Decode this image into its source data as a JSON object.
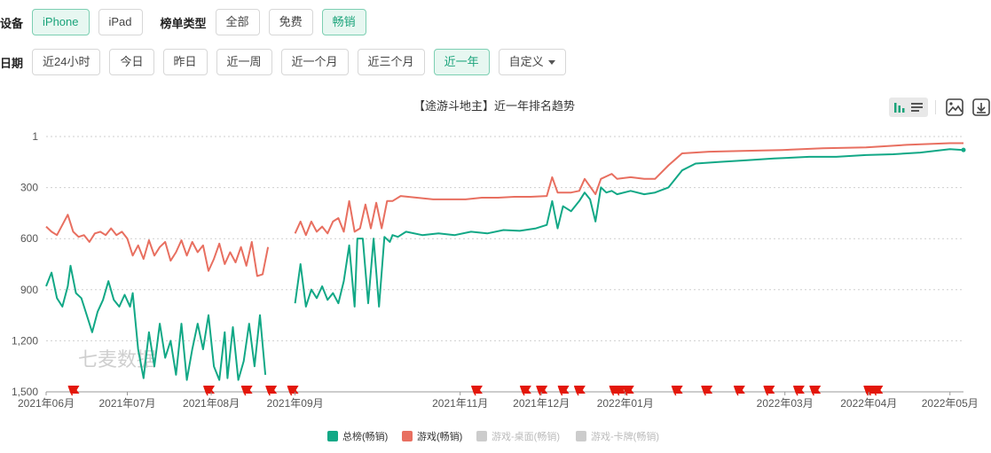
{
  "filters": {
    "device": {
      "label": "设备",
      "options": [
        "iPhone",
        "iPad"
      ],
      "selected": "iPhone"
    },
    "list_type": {
      "label": "榜单类型",
      "options": [
        "全部",
        "免费",
        "畅销"
      ],
      "selected": "畅销"
    },
    "date": {
      "label": "日期",
      "options": [
        "近24小时",
        "今日",
        "昨日",
        "近一周",
        "近一个月",
        "近三个月",
        "近一年"
      ],
      "selected": "近一年",
      "custom_label": "自定义"
    }
  },
  "toolbar": {
    "icons": [
      "bar-chart-icon",
      "list-icon",
      "image-icon",
      "download-icon"
    ]
  },
  "watermark": "七麦数据",
  "chart_data": {
    "type": "line",
    "title": "【途游斗地主】近一年排名趋势",
    "y_inverted": true,
    "ylim": [
      1,
      1500
    ],
    "yticks": [
      "1",
      "300",
      "600",
      "900",
      "1,200",
      "1,500"
    ],
    "x_range": [
      "2021-06-01",
      "2022-05-06"
    ],
    "xticks": [
      {
        "date": "2021-06-01",
        "label": "2021年06月"
      },
      {
        "date": "2021-07-01",
        "label": "2021年07月"
      },
      {
        "date": "2021-08-01",
        "label": "2021年08月"
      },
      {
        "date": "2021-09-01",
        "label": "2021年09月"
      },
      {
        "date": "2021-11-01",
        "label": "2021年11月"
      },
      {
        "date": "2021-12-01",
        "label": "2021年12月"
      },
      {
        "date": "2022-01-01",
        "label": "2022年01月"
      },
      {
        "date": "2022-03-01",
        "label": "2022年03月"
      },
      {
        "date": "2022-04-01",
        "label": "2022年04月"
      },
      {
        "date": "2022-05-01",
        "label": "2022年05月"
      }
    ],
    "grid": "horizontal dotted",
    "legend_position": "bottom",
    "series": [
      {
        "name": "总榜(畅销)",
        "color": "#12a886",
        "active": true,
        "points": [
          [
            "2021-06-01",
            880
          ],
          [
            "2021-06-03",
            800
          ],
          [
            "2021-06-05",
            950
          ],
          [
            "2021-06-07",
            1000
          ],
          [
            "2021-06-09",
            880
          ],
          [
            "2021-06-10",
            760
          ],
          [
            "2021-06-12",
            920
          ],
          [
            "2021-06-14",
            950
          ],
          [
            "2021-06-16",
            1050
          ],
          [
            "2021-06-18",
            1150
          ],
          [
            "2021-06-20",
            1030
          ],
          [
            "2021-06-22",
            960
          ],
          [
            "2021-06-24",
            850
          ],
          [
            "2021-06-26",
            960
          ],
          [
            "2021-06-28",
            1000
          ],
          [
            "2021-06-30",
            930
          ],
          [
            "2021-07-02",
            1000
          ],
          [
            "2021-07-03",
            920
          ],
          [
            "2021-07-05",
            1250
          ],
          [
            "2021-07-07",
            1420
          ],
          [
            "2021-07-09",
            1150
          ],
          [
            "2021-07-11",
            1350
          ],
          [
            "2021-07-13",
            1100
          ],
          [
            "2021-07-15",
            1300
          ],
          [
            "2021-07-17",
            1200
          ],
          [
            "2021-07-19",
            1400
          ],
          [
            "2021-07-21",
            1100
          ],
          [
            "2021-07-23",
            1430
          ],
          [
            "2021-07-25",
            1250
          ],
          [
            "2021-07-27",
            1100
          ],
          [
            "2021-07-29",
            1250
          ],
          [
            "2021-07-31",
            1050
          ],
          [
            "2021-08-02",
            1350
          ],
          [
            "2021-08-04",
            1430
          ],
          [
            "2021-08-06",
            1150
          ],
          [
            "2021-08-07",
            1420
          ],
          [
            "2021-08-09",
            1120
          ],
          [
            "2021-08-11",
            1430
          ],
          [
            "2021-08-13",
            1320
          ],
          [
            "2021-08-15",
            1100
          ],
          [
            "2021-08-17",
            1350
          ],
          [
            "2021-08-19",
            1050
          ],
          [
            "2021-08-21",
            1400
          ],
          [
            null,
            null
          ],
          [
            "2021-09-01",
            980
          ],
          [
            "2021-09-03",
            750
          ],
          [
            "2021-09-05",
            1000
          ],
          [
            "2021-09-07",
            900
          ],
          [
            "2021-09-09",
            950
          ],
          [
            "2021-09-11",
            880
          ],
          [
            "2021-09-13",
            960
          ],
          [
            "2021-09-15",
            920
          ],
          [
            "2021-09-17",
            980
          ],
          [
            "2021-09-19",
            850
          ],
          [
            "2021-09-21",
            640
          ],
          [
            "2021-09-23",
            1000
          ],
          [
            "2021-09-24",
            600
          ],
          [
            "2021-09-26",
            600
          ],
          [
            "2021-09-28",
            980
          ],
          [
            "2021-09-30",
            600
          ],
          [
            "2021-10-02",
            1000
          ],
          [
            "2021-10-04",
            590
          ],
          [
            "2021-10-06",
            620
          ],
          [
            "2021-10-07",
            580
          ],
          [
            "2021-10-09",
            590
          ],
          [
            "2021-10-12",
            560
          ],
          [
            "2021-10-18",
            580
          ],
          [
            "2021-10-24",
            570
          ],
          [
            "2021-10-30",
            580
          ],
          [
            "2021-11-05",
            560
          ],
          [
            "2021-11-11",
            570
          ],
          [
            "2021-11-17",
            550
          ],
          [
            "2021-11-23",
            555
          ],
          [
            "2021-11-29",
            540
          ],
          [
            "2021-12-03",
            520
          ],
          [
            "2021-12-05",
            380
          ],
          [
            "2021-12-07",
            540
          ],
          [
            "2021-12-09",
            410
          ],
          [
            "2021-12-12",
            440
          ],
          [
            "2021-12-15",
            380
          ],
          [
            "2021-12-17",
            330
          ],
          [
            "2021-12-19",
            370
          ],
          [
            "2021-12-21",
            500
          ],
          [
            "2021-12-23",
            300
          ],
          [
            "2021-12-25",
            330
          ],
          [
            "2021-12-27",
            320
          ],
          [
            "2021-12-29",
            340
          ],
          [
            "2022-01-03",
            320
          ],
          [
            "2022-01-08",
            340
          ],
          [
            "2022-01-12",
            330
          ],
          [
            "2022-01-17",
            300
          ],
          [
            "2022-01-22",
            200
          ],
          [
            "2022-01-27",
            160
          ],
          [
            "2022-02-05",
            150
          ],
          [
            "2022-02-15",
            140
          ],
          [
            "2022-02-25",
            130
          ],
          [
            "2022-03-10",
            120
          ],
          [
            "2022-03-20",
            120
          ],
          [
            "2022-03-31",
            110
          ],
          [
            "2022-04-10",
            105
          ],
          [
            "2022-04-20",
            95
          ],
          [
            "2022-05-01",
            75
          ],
          [
            "2022-05-06",
            80
          ]
        ]
      },
      {
        "name": "游戏(畅销)",
        "color": "#e86f60",
        "active": true,
        "points": [
          [
            "2021-06-01",
            530
          ],
          [
            "2021-06-03",
            560
          ],
          [
            "2021-06-05",
            580
          ],
          [
            "2021-06-07",
            520
          ],
          [
            "2021-06-09",
            460
          ],
          [
            "2021-06-11",
            560
          ],
          [
            "2021-06-13",
            590
          ],
          [
            "2021-06-15",
            580
          ],
          [
            "2021-06-17",
            620
          ],
          [
            "2021-06-19",
            570
          ],
          [
            "2021-06-21",
            560
          ],
          [
            "2021-06-23",
            580
          ],
          [
            "2021-06-25",
            540
          ],
          [
            "2021-06-27",
            580
          ],
          [
            "2021-06-29",
            560
          ],
          [
            "2021-07-01",
            600
          ],
          [
            "2021-07-03",
            700
          ],
          [
            "2021-07-05",
            640
          ],
          [
            "2021-07-07",
            720
          ],
          [
            "2021-07-09",
            610
          ],
          [
            "2021-07-11",
            700
          ],
          [
            "2021-07-13",
            650
          ],
          [
            "2021-07-15",
            620
          ],
          [
            "2021-07-17",
            730
          ],
          [
            "2021-07-19",
            680
          ],
          [
            "2021-07-21",
            610
          ],
          [
            "2021-07-23",
            700
          ],
          [
            "2021-07-25",
            620
          ],
          [
            "2021-07-27",
            680
          ],
          [
            "2021-07-29",
            640
          ],
          [
            "2021-07-31",
            790
          ],
          [
            "2021-08-02",
            720
          ],
          [
            "2021-08-04",
            630
          ],
          [
            "2021-08-06",
            750
          ],
          [
            "2021-08-08",
            680
          ],
          [
            "2021-08-10",
            740
          ],
          [
            "2021-08-12",
            650
          ],
          [
            "2021-08-14",
            760
          ],
          [
            "2021-08-16",
            620
          ],
          [
            "2021-08-18",
            820
          ],
          [
            "2021-08-20",
            810
          ],
          [
            "2021-08-22",
            650
          ],
          [
            null,
            null
          ],
          [
            "2021-09-01",
            570
          ],
          [
            "2021-09-03",
            500
          ],
          [
            "2021-09-05",
            580
          ],
          [
            "2021-09-07",
            500
          ],
          [
            "2021-09-09",
            560
          ],
          [
            "2021-09-11",
            530
          ],
          [
            "2021-09-13",
            570
          ],
          [
            "2021-09-15",
            500
          ],
          [
            "2021-09-17",
            480
          ],
          [
            "2021-09-19",
            560
          ],
          [
            "2021-09-21",
            380
          ],
          [
            "2021-09-23",
            560
          ],
          [
            "2021-09-25",
            540
          ],
          [
            "2021-09-27",
            400
          ],
          [
            "2021-09-29",
            540
          ],
          [
            "2021-10-01",
            390
          ],
          [
            "2021-10-03",
            540
          ],
          [
            "2021-10-05",
            380
          ],
          [
            "2021-10-07",
            380
          ],
          [
            "2021-10-10",
            350
          ],
          [
            "2021-10-16",
            360
          ],
          [
            "2021-10-22",
            370
          ],
          [
            "2021-10-28",
            370
          ],
          [
            "2021-11-03",
            370
          ],
          [
            "2021-11-09",
            360
          ],
          [
            "2021-11-15",
            360
          ],
          [
            "2021-11-21",
            355
          ],
          [
            "2021-11-27",
            355
          ],
          [
            "2021-12-03",
            350
          ],
          [
            "2021-12-05",
            240
          ],
          [
            "2021-12-07",
            330
          ],
          [
            "2021-12-09",
            330
          ],
          [
            "2021-12-12",
            330
          ],
          [
            "2021-12-15",
            320
          ],
          [
            "2021-12-17",
            250
          ],
          [
            "2021-12-21",
            340
          ],
          [
            "2021-12-23",
            250
          ],
          [
            "2021-12-27",
            220
          ],
          [
            "2021-12-29",
            250
          ],
          [
            "2022-01-03",
            240
          ],
          [
            "2022-01-08",
            250
          ],
          [
            "2022-01-12",
            250
          ],
          [
            "2022-01-17",
            170
          ],
          [
            "2022-01-22",
            100
          ],
          [
            "2022-02-01",
            90
          ],
          [
            "2022-02-15",
            85
          ],
          [
            "2022-02-28",
            80
          ],
          [
            "2022-03-15",
            70
          ],
          [
            "2022-03-31",
            65
          ],
          [
            "2022-04-15",
            50
          ],
          [
            "2022-05-01",
            40
          ],
          [
            "2022-05-06",
            40
          ]
        ]
      },
      {
        "name": "游戏-桌面(畅销)",
        "color": "#cccccc",
        "active": false,
        "points": []
      },
      {
        "name": "游戏-卡牌(畅销)",
        "color": "#cccccc",
        "active": false,
        "points": []
      }
    ],
    "flag_dates": [
      "2021-06-11",
      "2021-07-31",
      "2021-08-14",
      "2021-08-23",
      "2021-08-31",
      "2021-11-07",
      "2021-11-25",
      "2021-12-01",
      "2021-12-09",
      "2021-12-15",
      "2021-12-28",
      "2021-12-30",
      "2022-01-02",
      "2022-01-20",
      "2022-01-31",
      "2022-02-12",
      "2022-02-23",
      "2022-03-06",
      "2022-03-12",
      "2022-04-01",
      "2022-04-02",
      "2022-04-04"
    ],
    "flag_color": "#e3170a"
  }
}
